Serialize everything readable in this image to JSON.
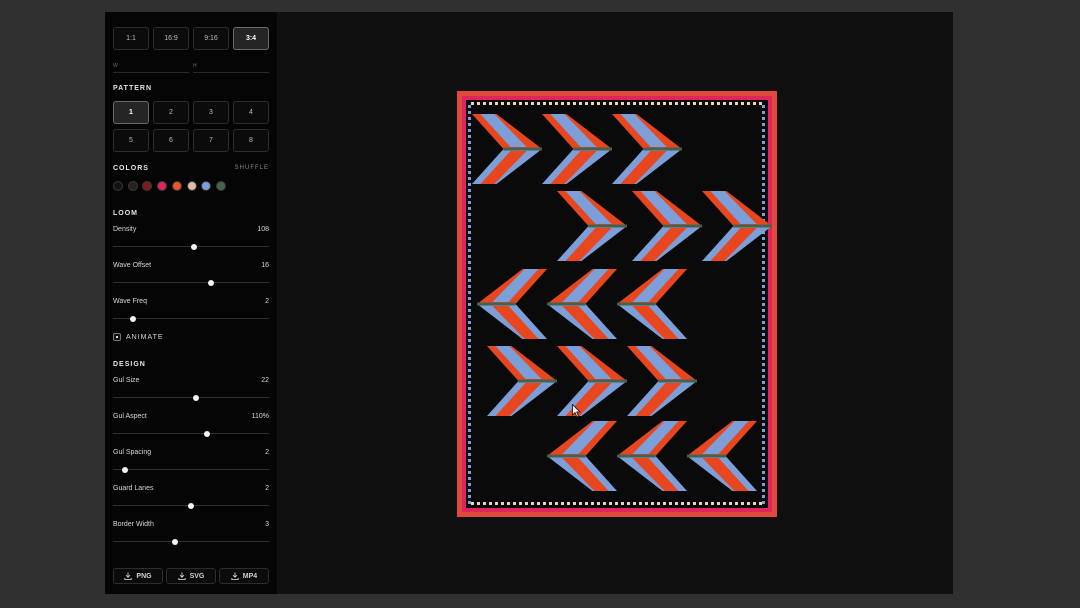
{
  "aspect_ratios": [
    {
      "label": "1:1",
      "active": false
    },
    {
      "label": "16:9",
      "active": false
    },
    {
      "label": "9:16",
      "active": false
    },
    {
      "label": "3:4",
      "active": true
    }
  ],
  "size_fields": {
    "w_label": "W",
    "h_label": "H"
  },
  "pattern": {
    "title": "PATTERN",
    "options": [
      "1",
      "2",
      "3",
      "4",
      "5",
      "6",
      "7",
      "8"
    ],
    "selected": "1"
  },
  "colors": {
    "title": "COLORS",
    "shuffle_label": "SHUFFLE",
    "palette": [
      "#141414",
      "#2a2020",
      "#7a1a22",
      "#e0245e",
      "#e8552e",
      "#e0b9a8",
      "#7c9fd9",
      "#47624c"
    ]
  },
  "loom": {
    "title": "LOOM",
    "sliders": [
      {
        "label": "Density",
        "value": "108",
        "level": 0.52
      },
      {
        "label": "Wave Offset",
        "value": "16",
        "level": 0.63
      },
      {
        "label": "Wave Freq",
        "value": "2",
        "level": 0.13
      }
    ],
    "animate_label": "ANIMATE",
    "animate_checked": true
  },
  "design": {
    "title": "DESIGN",
    "sliders": [
      {
        "label": "Gul Size",
        "value": "22",
        "level": 0.53
      },
      {
        "label": "Gul Aspect",
        "value": "110%",
        "level": 0.6
      },
      {
        "label": "Gul Spacing",
        "value": "2",
        "level": 0.08
      },
      {
        "label": "Guard Lanes",
        "value": "2",
        "level": 0.5
      },
      {
        "label": "Border Width",
        "value": "3",
        "level": 0.4
      }
    ]
  },
  "export": [
    "PNG",
    "SVG",
    "MP4"
  ],
  "rug_colors": {
    "background": "#0a0a0a",
    "border_red": "#e04a3c",
    "border_pink": "#e0245e",
    "blue": "#7c9fd9",
    "orange": "#e8461e",
    "green": "#47624c",
    "light": "#f0d0c0"
  }
}
